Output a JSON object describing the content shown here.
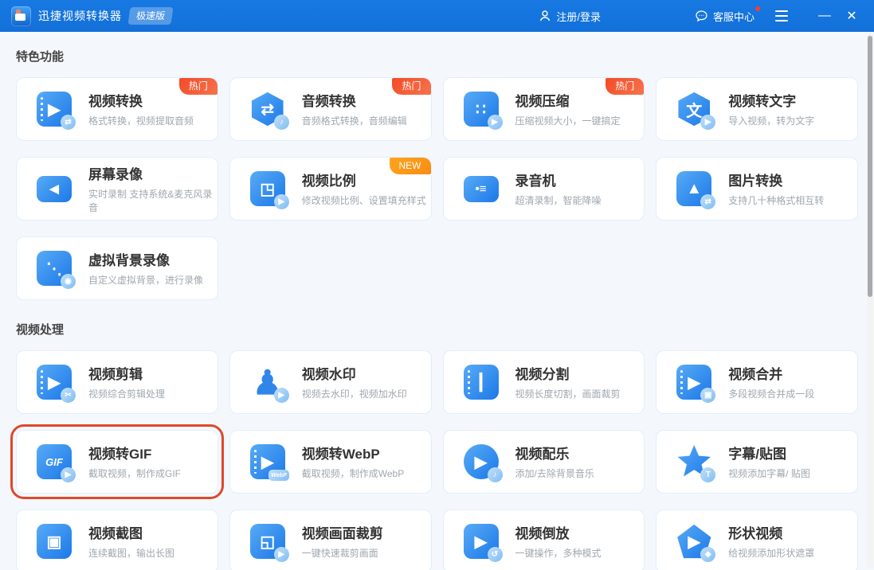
{
  "window": {
    "title": "迅捷视频转换器",
    "edition": "极速版",
    "login": "注册/登录",
    "support": "客服中心"
  },
  "colors": {
    "titlebar_blue": "#1474de",
    "icon_blue_light": "#58abf6",
    "icon_blue_dark": "#1b78e8",
    "hot_badge_red": "#f4502a",
    "new_badge_orange": "#fa9d18",
    "highlight_border_red": "#e0482a",
    "card_border": "#e2eefb",
    "page_background": "#f4f8fd"
  },
  "sections": [
    {
      "title": "特色功能",
      "cards": [
        {
          "title": "视频转换",
          "subtitle": "格式转换，视频提取音频",
          "badge": "热门",
          "badge_type": "hot",
          "icon": "video-convert-icon",
          "shape": "square",
          "glyph": "▶",
          "film": true,
          "sub_glyph": "⇄"
        },
        {
          "title": "音频转换",
          "subtitle": "音频格式转换，音频编辑",
          "badge": "热门",
          "badge_type": "hot",
          "icon": "audio-convert-icon",
          "shape": "hexagon",
          "glyph": "⇄",
          "sub_glyph": "♪"
        },
        {
          "title": "视频压缩",
          "subtitle": "压缩视频大小，一键搞定",
          "badge": "热门",
          "badge_type": "hot",
          "icon": "video-compress-icon",
          "shape": "square",
          "glyph": "∷",
          "sub_glyph": "▶"
        },
        {
          "title": "视频转文字",
          "subtitle": "导入视频，转为文字",
          "icon": "video-to-text-icon",
          "shape": "hexagon",
          "glyph": "文",
          "sub_glyph": "▶"
        },
        {
          "title": "屏幕录像",
          "subtitle": "实时录制 支持系统&麦克风录音",
          "icon": "screen-record-icon",
          "shape": "wide",
          "glyph": "◀"
        },
        {
          "title": "视频比例",
          "subtitle": "修改视频比例、设置填充样式",
          "badge": "NEW",
          "badge_type": "new",
          "icon": "aspect-ratio-icon",
          "shape": "square",
          "glyph": "◳",
          "sub_glyph": "▶"
        },
        {
          "title": "录音机",
          "subtitle": "超清录制，智能降噪",
          "icon": "voice-recorder-icon",
          "shape": "wide",
          "glyph": "•≡"
        },
        {
          "title": "图片转换",
          "subtitle": "支持几十种格式相互转",
          "icon": "image-convert-icon",
          "shape": "square",
          "glyph": "▲",
          "sub_glyph": "⇄"
        },
        {
          "title": "虚拟背景录像",
          "subtitle": "自定义虚拟背景，进行录像",
          "icon": "virtual-background-record-icon",
          "shape": "square",
          "glyph": "⋱",
          "sub_glyph": "◉"
        }
      ]
    },
    {
      "title": "视频处理",
      "cards": [
        {
          "title": "视频剪辑",
          "subtitle": "视频综合剪辑处理",
          "icon": "video-edit-icon",
          "shape": "square",
          "glyph": "▶",
          "film": true,
          "sub_glyph": "✂"
        },
        {
          "title": "视频水印",
          "subtitle": "视频去水印，视频加水印",
          "icon": "video-watermark-icon",
          "shape": "plain",
          "glyph": "♟",
          "sub_glyph": "▶"
        },
        {
          "title": "视频分割",
          "subtitle": "视频长度切割，画面裁剪",
          "icon": "video-split-icon",
          "shape": "square",
          "glyph": "┃",
          "film": true
        },
        {
          "title": "视频合并",
          "subtitle": "多段视频合并成一段",
          "icon": "video-merge-icon",
          "shape": "square",
          "glyph": "▶",
          "film": true,
          "sub_glyph": "▣"
        },
        {
          "title": "视频转GIF",
          "subtitle": "截取视频，制作成GIF",
          "highlight": true,
          "icon": "video-to-gif-icon",
          "shape": "square",
          "glyph": "GIF",
          "text_glyph": true,
          "sub_glyph": "▶"
        },
        {
          "title": "视频转WebP",
          "subtitle": "截取视频，制作成WebP",
          "icon": "video-to-webp-icon",
          "shape": "square",
          "glyph": "▶",
          "film": true,
          "sub_glyph": "WebP",
          "sub_text": true
        },
        {
          "title": "视频配乐",
          "subtitle": "添加/去除背景音乐",
          "icon": "video-music-icon",
          "shape": "circle",
          "glyph": "▶",
          "sub_glyph": "♪"
        },
        {
          "title": "字幕/贴图",
          "subtitle": "视频添加字幕/ 贴图",
          "icon": "subtitle-sticker-icon",
          "shape": "star",
          "glyph": "",
          "sub_glyph": "T"
        },
        {
          "title": "视频截图",
          "subtitle": "连续截图，输出长图",
          "icon": "video-screenshot-icon",
          "shape": "square",
          "glyph": "▣"
        },
        {
          "title": "视频画面裁剪",
          "subtitle": "一键快速裁剪画面",
          "icon": "video-crop-icon",
          "shape": "square",
          "glyph": "◱",
          "sub_glyph": "▶"
        },
        {
          "title": "视频倒放",
          "subtitle": "一键操作，多种模式",
          "icon": "video-reverse-icon",
          "shape": "square",
          "glyph": "▶",
          "sub_glyph": "↺"
        },
        {
          "title": "形状视频",
          "subtitle": "给视频添加形状遮罩",
          "icon": "shape-video-icon",
          "shape": "pentagon",
          "glyph": "▶",
          "sub_glyph": "◆"
        }
      ]
    }
  ]
}
